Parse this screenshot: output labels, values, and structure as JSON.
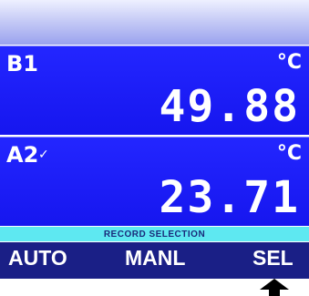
{
  "channels": [
    {
      "label": "B1",
      "unit": "°C",
      "value": "49.88",
      "selected": false
    },
    {
      "label": "A2",
      "unit": "°C",
      "value": "23.71",
      "selected": true,
      "check_mark": "✓"
    }
  ],
  "record_selection": {
    "label": "RECORD SELECTION"
  },
  "softkeys": {
    "auto": "AUTO",
    "manl": "MANL",
    "sel": "SEL"
  },
  "indicator": {
    "icon": "up-arrow-icon",
    "points_to": "SEL"
  },
  "colors": {
    "panel": "#2020ff",
    "strip": "#5ee8f1",
    "softkey_bar": "#1a1f86",
    "text": "#ffffff"
  }
}
